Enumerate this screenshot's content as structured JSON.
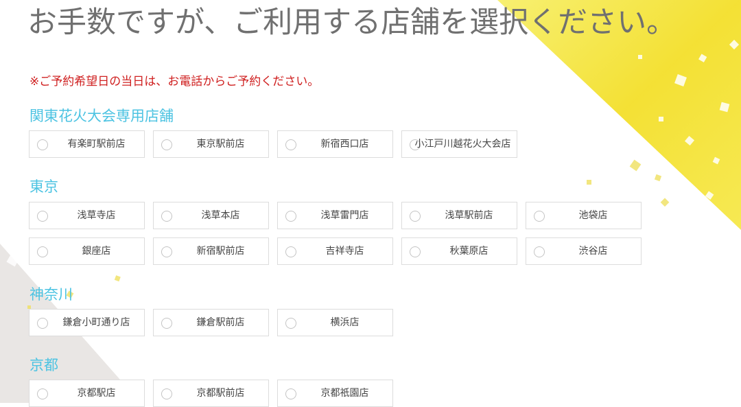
{
  "heading": "お手数ですが、ご利用する店舗を選択ください。",
  "notice": "※ご予約希望日の当日は、お電話からご予約ください。",
  "colors": {
    "section_title": "#4cc3e2",
    "notice": "#cf1f1f",
    "heading": "#707070",
    "accent_yellow": "#f5e63c"
  },
  "sections": [
    {
      "title": "関東花火大会専用店舗",
      "stores": [
        "有楽町駅前店",
        "東京駅前店",
        "新宿西口店",
        "小江戸川越花火大会店"
      ]
    },
    {
      "title": "東京",
      "stores": [
        "浅草寺店",
        "浅草本店",
        "浅草雷門店",
        "浅草駅前店",
        "池袋店",
        "銀座店",
        "新宿駅前店",
        "吉祥寺店",
        "秋葉原店",
        "渋谷店"
      ]
    },
    {
      "title": "神奈川",
      "stores": [
        "鎌倉小町通り店",
        "鎌倉駅前店",
        "横浜店"
      ]
    },
    {
      "title": "京都",
      "stores": [
        "京都駅店",
        "京都駅前店",
        "京都祇園店"
      ]
    }
  ]
}
